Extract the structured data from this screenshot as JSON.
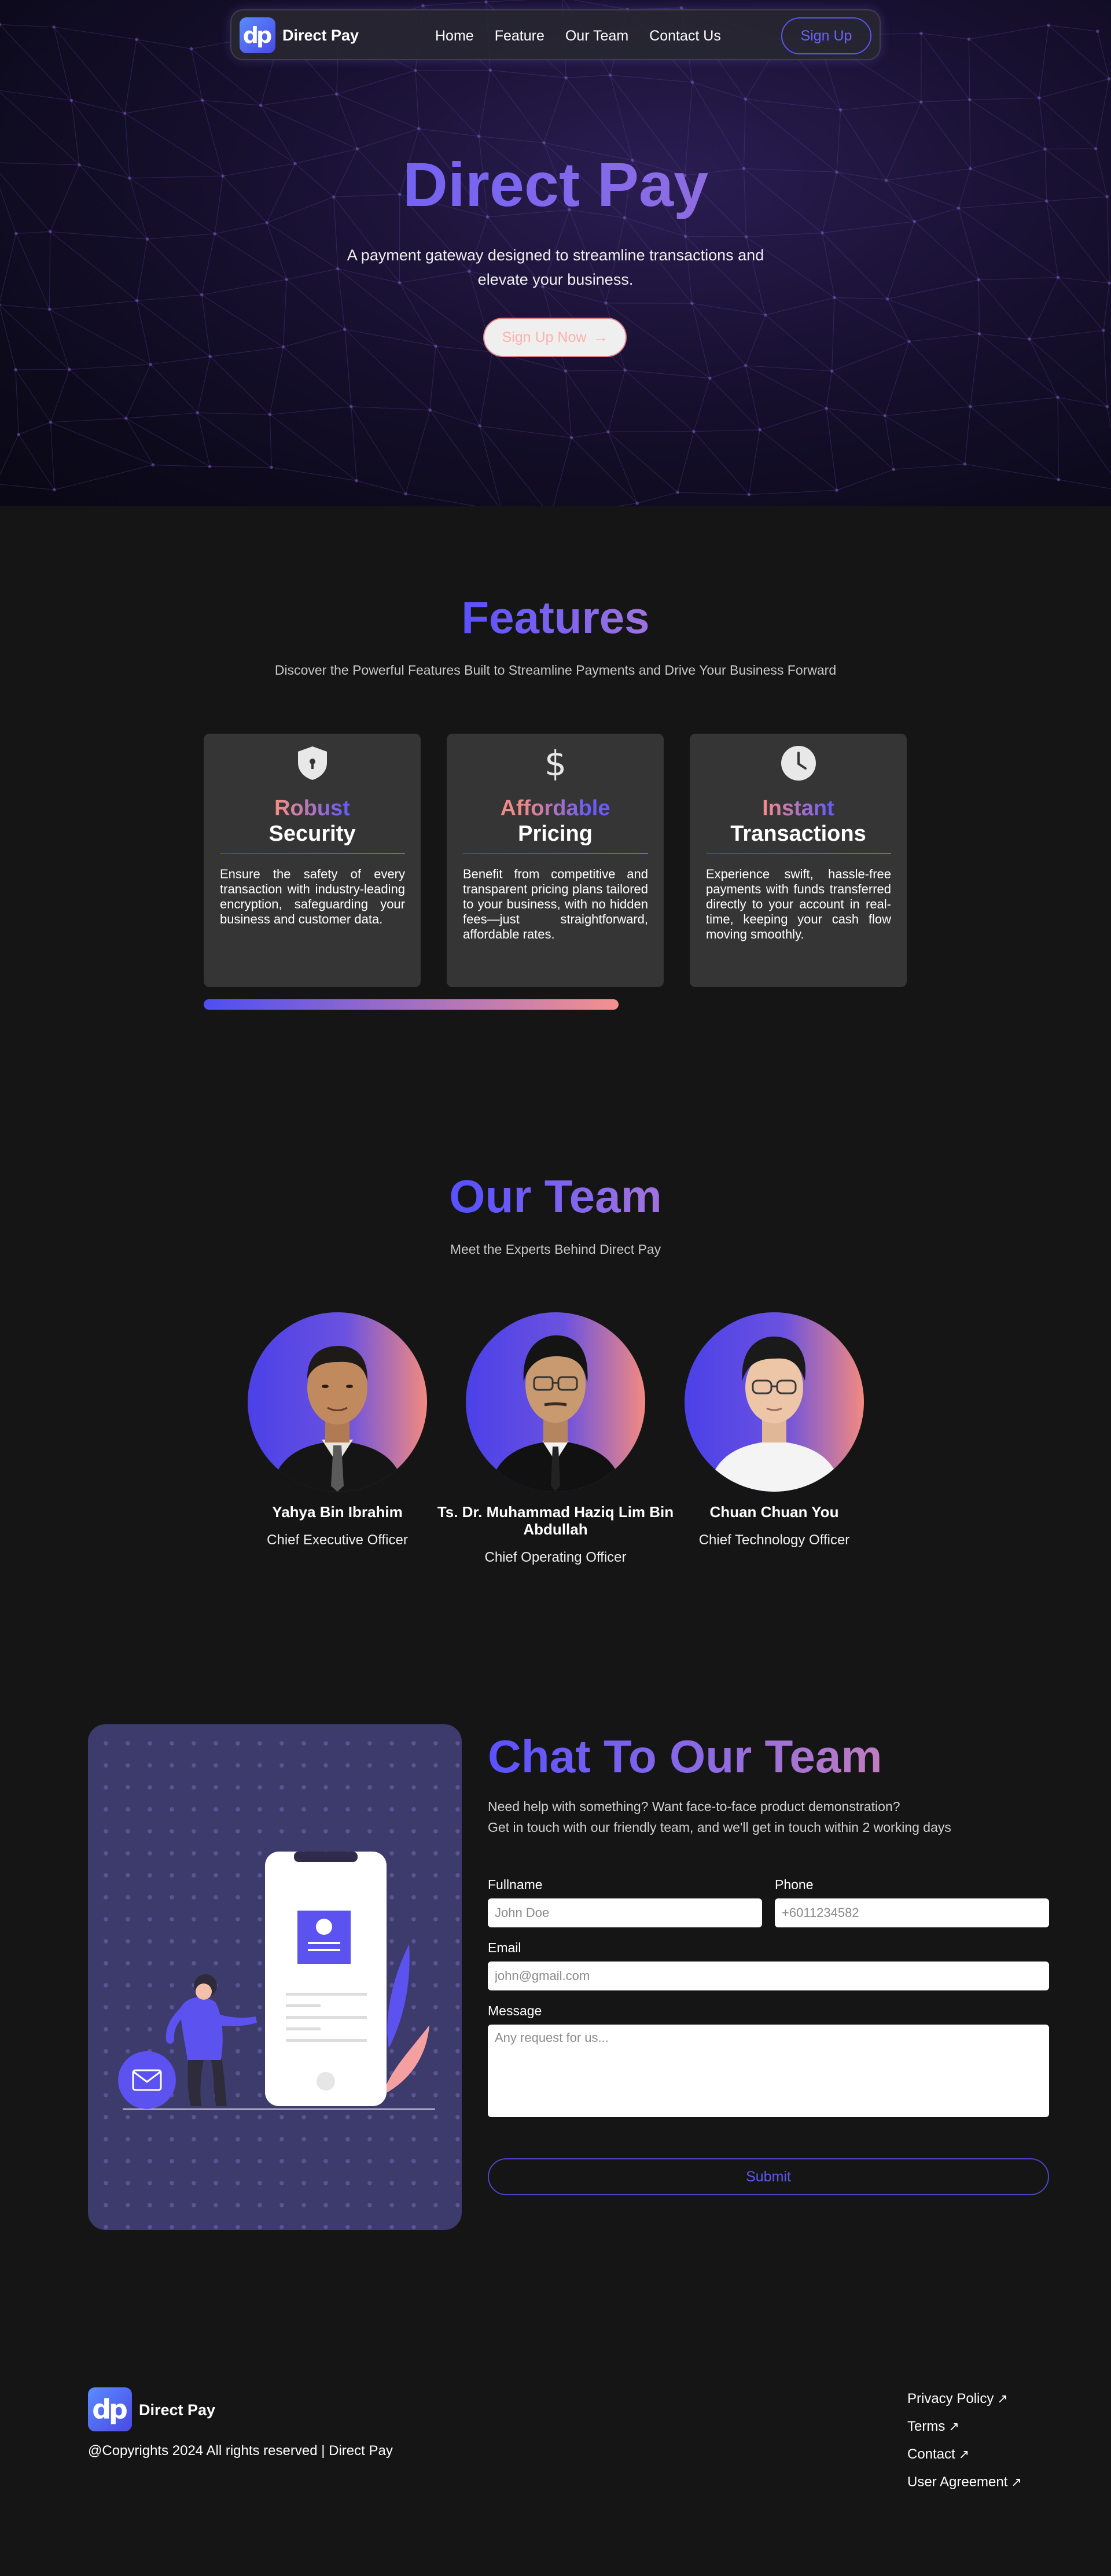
{
  "nav": {
    "logo_text": "dp",
    "brand": "Direct Pay",
    "links": [
      "Home",
      "Feature",
      "Our Team",
      "Contact Us"
    ],
    "signup": "Sign Up"
  },
  "hero": {
    "title": "Direct Pay",
    "subtitle": "A payment gateway designed to streamline transactions and elevate your business.",
    "cta": "Sign Up Now",
    "cta_arrow": "→"
  },
  "features": {
    "title": "Features",
    "subtitle": "Discover the Powerful Features Built to Streamline Payments and Drive Your Business Forward",
    "cards": [
      {
        "icon": "shield-icon",
        "k1": "Robust",
        "k2": "Security",
        "text": "Ensure the safety of every transaction with industry-leading encryption, safeguarding your business and customer data."
      },
      {
        "icon": "dollar-icon",
        "k1": "Affordable",
        "k2": "Pricing",
        "text": "Benefit from competitive and transparent pricing plans tailored to your business, with no hidden fees—just straightforward, affordable rates."
      },
      {
        "icon": "clock-icon",
        "k1": "Instant",
        "k2": "Transactions",
        "text": "Experience swift, hassle-free payments with funds transferred directly to your account in real-time, keeping your cash flow moving smoothly."
      }
    ],
    "scroll_progress": 0.5
  },
  "team": {
    "title": "Our Team",
    "subtitle": "Meet the Experts Behind Direct Pay",
    "members": [
      {
        "name": "Yahya Bin Ibrahim",
        "role": "Chief Executive Officer"
      },
      {
        "name": "Ts. Dr. Muhammad Haziq Lim Bin Abdullah",
        "role": "Chief Operating Officer"
      },
      {
        "name": "Chuan Chuan You",
        "role": "Chief Technology Officer"
      }
    ]
  },
  "contact": {
    "title": "Chat To Our Team",
    "line1": "Need help with something? Want face-to-face product demonstration?",
    "line2": "Get in touch with our friendly team, and we'll get in touch within 2 working days",
    "fullname_label": "Fullname",
    "fullname_placeholder": "John Doe",
    "phone_label": "Phone",
    "phone_placeholder": "+6011234582",
    "email_label": "Email",
    "email_placeholder": "john@gmail.com",
    "message_label": "Message",
    "message_placeholder": "Any request for us...",
    "submit": "Submit"
  },
  "footer": {
    "logo_text": "dp",
    "brand": "Direct Pay",
    "copyright": "@Copyrights 2024 All rights reserved | Direct Pay",
    "links": [
      "Privacy Policy",
      "Terms",
      "Contact",
      "User Agreement"
    ],
    "link_arrow": "↗"
  },
  "colors": {
    "accent": "#5a52ff",
    "coral": "#f28a80",
    "background": "#151515",
    "card": "#353535"
  }
}
